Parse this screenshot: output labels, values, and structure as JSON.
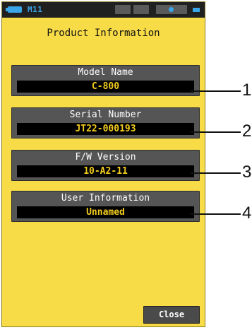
{
  "status_bar": {
    "status_text": "M11",
    "battery_color": "#3aa6e8"
  },
  "page": {
    "title": "Product Information"
  },
  "fields": {
    "model_name": {
      "label": "Model Name",
      "value": "C-800"
    },
    "serial_number": {
      "label": "Serial Number",
      "value": "JT22-000193"
    },
    "fw_version": {
      "label": "F/W Version",
      "value": "10-A2-11"
    },
    "user_information": {
      "label": "User Information",
      "value": "Unnamed"
    }
  },
  "buttons": {
    "close_label": "Close"
  },
  "callouts": [
    "1",
    "2",
    "3",
    "4"
  ],
  "colors": {
    "screen_background": "#f7dc48",
    "panel_background": "#555555",
    "value_text": "#f2cc1c",
    "accent": "#3aa6e8"
  }
}
